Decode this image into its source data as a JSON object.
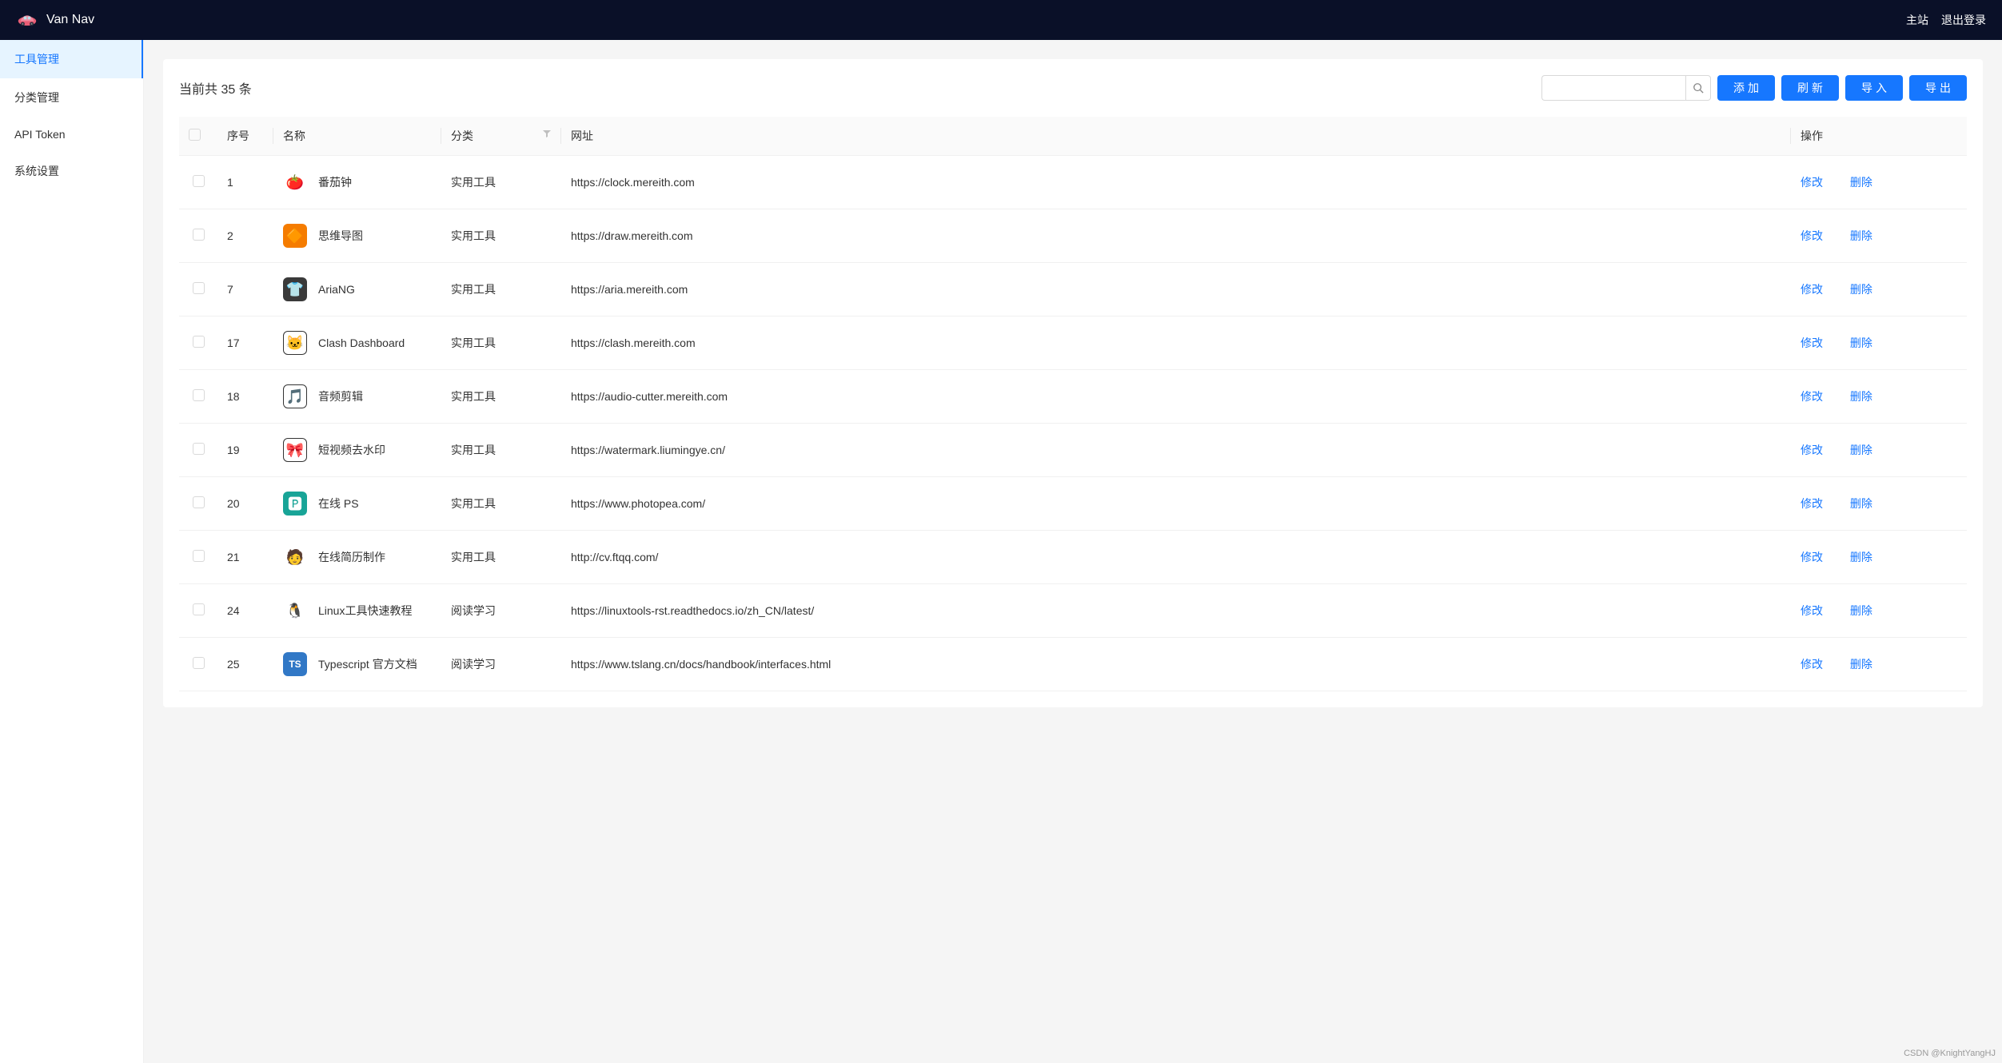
{
  "header": {
    "title": "Van Nav",
    "links": {
      "main": "主站",
      "logout": "退出登录"
    }
  },
  "sidebar": {
    "items": [
      {
        "label": "工具管理",
        "active": true
      },
      {
        "label": "分类管理",
        "active": false
      },
      {
        "label": "API Token",
        "active": false
      },
      {
        "label": "系统设置",
        "active": false
      }
    ]
  },
  "toolbar": {
    "count_prefix": "当前共 ",
    "count": "35",
    "count_suffix": " 条",
    "add": "添加",
    "refresh": "刷新",
    "import": "导入",
    "export": "导出",
    "search_placeholder": ""
  },
  "table": {
    "headers": {
      "seq": "序号",
      "name": "名称",
      "category": "分类",
      "url": "网址",
      "action": "操作"
    },
    "actions": {
      "edit": "修改",
      "delete": "删除"
    },
    "rows": [
      {
        "seq": "1",
        "name": "番茄钟",
        "category": "实用工具",
        "url": "https://clock.mereith.com",
        "icon_bg": "#fff",
        "icon_emoji": "🍅"
      },
      {
        "seq": "2",
        "name": "思维导图",
        "category": "实用工具",
        "url": "https://draw.mereith.com",
        "icon_bg": "#f57c00",
        "icon_emoji": "🔶"
      },
      {
        "seq": "7",
        "name": "AriaNG",
        "category": "实用工具",
        "url": "https://aria.mereith.com",
        "icon_bg": "#3a3a3a",
        "icon_emoji": "👕"
      },
      {
        "seq": "17",
        "name": "Clash Dashboard",
        "category": "实用工具",
        "url": "https://clash.mereith.com",
        "icon_bg": "#fff",
        "icon_emoji": "🐱"
      },
      {
        "seq": "18",
        "name": "音频剪辑",
        "category": "实用工具",
        "url": "https://audio-cutter.mereith.com",
        "icon_bg": "#fff",
        "icon_emoji": "🎵"
      },
      {
        "seq": "19",
        "name": "短视频去水印",
        "category": "实用工具",
        "url": "https://watermark.liumingye.cn/",
        "icon_bg": "#fff",
        "icon_emoji": "🎀"
      },
      {
        "seq": "20",
        "name": "在线 PS",
        "category": "实用工具",
        "url": "https://www.photopea.com/",
        "icon_bg": "#18a497",
        "icon_emoji": "🅿"
      },
      {
        "seq": "21",
        "name": "在线简历制作",
        "category": "实用工具",
        "url": "http://cv.ftqq.com/",
        "icon_bg": "#fff",
        "icon_emoji": "🧑"
      },
      {
        "seq": "24",
        "name": "Linux工具快速教程",
        "category": "阅读学习",
        "url": "https://linuxtools-rst.readthedocs.io/zh_CN/latest/",
        "icon_bg": "#fff",
        "icon_emoji": "🐧"
      },
      {
        "seq": "25",
        "name": "Typescript 官方文档",
        "category": "阅读学习",
        "url": "https://www.tslang.cn/docs/handbook/interfaces.html",
        "icon_bg": "#3178c6",
        "icon_emoji": "TS"
      }
    ]
  },
  "footer": {
    "watermark": "CSDN @KnightYangHJ"
  }
}
